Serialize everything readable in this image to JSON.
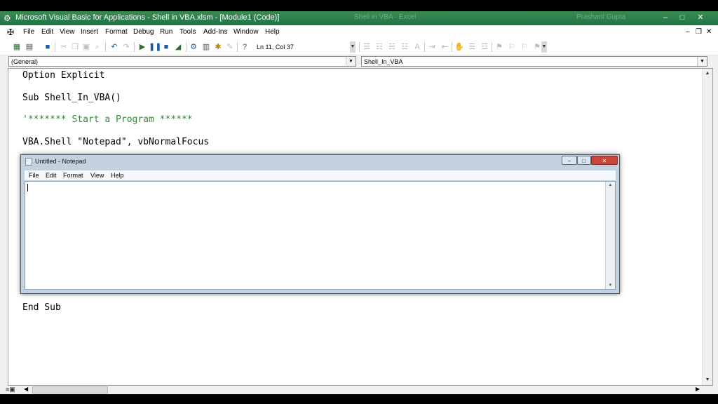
{
  "window": {
    "app_icon": "vba-icon",
    "title": "Microsoft Visual Basic for Applications - Shell in VBA.xlsm - [Module1 (Code)]",
    "ghost_text_1": "Shell in VBA - Excel",
    "ghost_text_2": "Prashant Gupta",
    "minimize": "–",
    "maximize": "□",
    "close": "✕"
  },
  "menubar": {
    "items": [
      "File",
      "Edit",
      "View",
      "Insert",
      "Format",
      "Debug",
      "Run",
      "Tools",
      "Add-Ins",
      "Window",
      "Help"
    ],
    "mdi_minimize": "–",
    "mdi_restore": "❐",
    "mdi_close": "✕"
  },
  "toolbar": {
    "position": "Ln 11, Col 37",
    "icons": [
      "excel-icon",
      "insert-module-icon",
      "save-icon",
      "cut-icon",
      "copy-icon",
      "paste-icon",
      "find-icon",
      "undo-icon",
      "redo-icon",
      "run-icon",
      "break-icon",
      "reset-icon",
      "design-mode-icon",
      "project-explorer-icon",
      "properties-icon",
      "object-browser-icon",
      "toolbox-icon",
      "help-icon"
    ]
  },
  "combos": {
    "object": "(General)",
    "procedure": "Shell_In_VBA"
  },
  "code": {
    "lines": [
      "Option Explicit",
      "Sub Shell_In_VBA()",
      "'******* Start a Program ******",
      "VBA.Shell \"Notepad\", vbNormalFocus",
      "End Sub"
    ]
  },
  "notepad": {
    "title": "Untitled - Notepad",
    "menu": [
      "File",
      "Edit",
      "Format",
      "View",
      "Help"
    ],
    "content": ""
  },
  "colors": {
    "title_bar": "#217346",
    "comment": "#2e8b2e",
    "notepad_close": "#c9463d"
  }
}
